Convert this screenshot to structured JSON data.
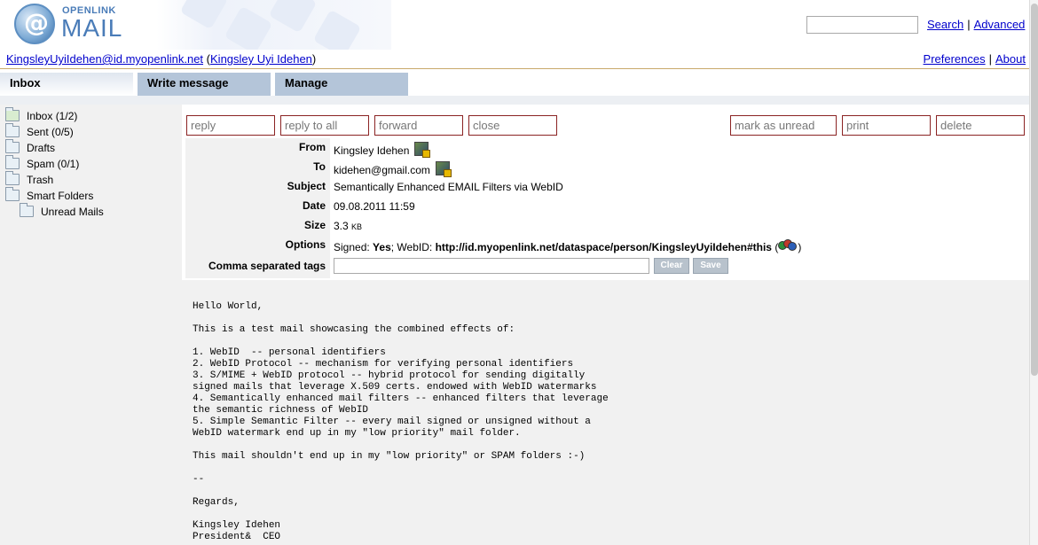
{
  "logo": {
    "top": "OPENLINK",
    "bottom": "MAIL"
  },
  "search": {
    "value": "",
    "search_label": "Search",
    "sep": "|",
    "advanced_label": "Advanced"
  },
  "user": {
    "email": "KingsleyUyiIdehen@id.myopenlink.net",
    "open": "(",
    "name": "Kingsley Uyi Idehen",
    "close": ")"
  },
  "toplinks": {
    "preferences": "Preferences",
    "sep": "|",
    "about": "About"
  },
  "tabs": [
    "Inbox",
    "Write message",
    "Manage"
  ],
  "folders": [
    {
      "label": "Inbox (1/2)"
    },
    {
      "label": "Sent (0/5)"
    },
    {
      "label": "Drafts"
    },
    {
      "label": "Spam (0/1)"
    },
    {
      "label": "Trash"
    },
    {
      "label": "Smart Folders"
    },
    {
      "label": "Unread Mails"
    }
  ],
  "actions": [
    "reply",
    "reply to all",
    "forward",
    "close",
    "mark as unread",
    "print",
    "delete"
  ],
  "header": {
    "from_label": "From",
    "from_value": "Kingsley Idehen",
    "to_label": "To",
    "to_value": "kidehen@gmail.com",
    "subject_label": "Subject",
    "subject_value": "Semantically Enhanced EMAIL Filters via WebID",
    "date_label": "Date",
    "date_value": "09.08.2011 11:59",
    "size_label": "Size",
    "size_value": "3.3",
    "size_unit": "KB",
    "options_label": "Options",
    "options_signed": "Signed:",
    "options_signed_value": "Yes",
    "options_webid": "; WebID:",
    "options_webid_value": "http://id.myopenlink.net/dataspace/person/KingsleyUyiIdehen#this",
    "options_open": "(",
    "options_close": ")",
    "tags_label": "Comma separated tags",
    "tags_value": "",
    "clear_label": "Clear",
    "save_label": "Save"
  },
  "body": "Hello World,\n\nThis is a test mail showcasing the combined effects of:\n\n1. WebID  -- personal identifiers\n2. WebID Protocol -- mechanism for verifying personal identifiers\n3. S/MIME + WebID protocol -- hybrid protocol for sending digitally\nsigned mails that leverage X.509 certs. endowed with WebID watermarks\n4. Semantically enhanced mail filters -- enhanced filters that leverage\nthe semantic richness of WebID\n5. Simple Semantic Filter -- every mail signed or unsigned without a\nWebID watermark end up in my \"low priority\" mail folder.\n\nThis mail shouldn't end up in my \"low priority\" or SPAM folders :-)\n\n--\n\nRegards,\n\nKingsley Idehen\nPresident&  CEO"
}
